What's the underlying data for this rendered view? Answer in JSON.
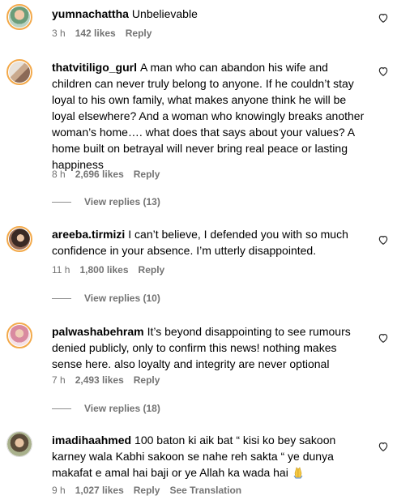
{
  "comments": [
    {
      "username": "yumnachattha",
      "text": "Unbelievable",
      "time": "3 h",
      "likes": "142 likes",
      "reply": "Reply"
    },
    {
      "username": "thatvitiligo_gurl",
      "text": "A man who can abandon his wife and children can never truly belong to anyone. If he couldn’t stay loyal to his own family, what makes anyone think he will be loyal elsewhere? And a woman who knowingly breaks another woman’s home…. what does that says about your values? A home built on betrayal will never bring real peace or lasting happiness",
      "time": "8 h",
      "likes": "2,696 likes",
      "reply": "Reply",
      "view_replies": "View replies (13)"
    },
    {
      "username": "areeba.tirmizi",
      "text": "I can’t believe, I defended you with so much confidence in your absence. I’m utterly disappointed.",
      "time": "11 h",
      "likes": "1,800 likes",
      "reply": "Reply",
      "view_replies": "View replies (10)"
    },
    {
      "username": "palwashabehram",
      "text": "It’s beyond disappointing to see rumours denied publicly, only to confirm this news! nothing makes sense here. also loyalty and integrity are never optional",
      "time": "7 h",
      "likes": "2,493 likes",
      "reply": "Reply",
      "view_replies": "View replies (18)"
    },
    {
      "username": "imadihaahmed",
      "text": "100 baton ki aik bat “ kisi ko bey sakoon karney wala Kabhi sakoon se nahe reh sakta “ ye dunya makafat e amal hai baji or ye Allah ka wada hai",
      "emoji": "pray-emoji",
      "time": "9 h",
      "likes": "1,027 likes",
      "reply": "Reply",
      "see_translation": "See Translation"
    }
  ],
  "icons": {
    "like": "heart-outline-icon"
  },
  "colors": {
    "meta_text": "#737373",
    "story_ring": "#f3a94a"
  }
}
